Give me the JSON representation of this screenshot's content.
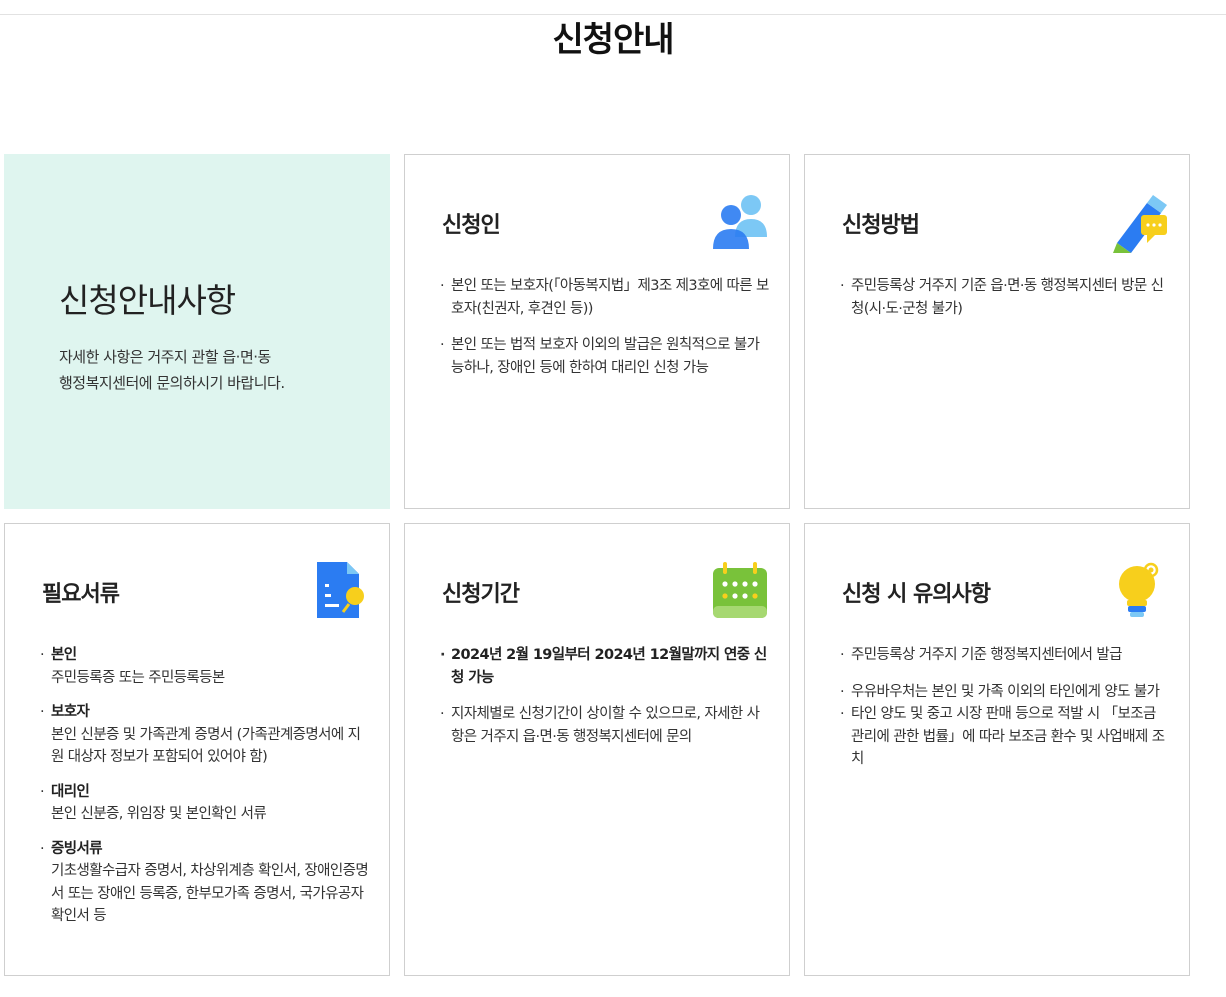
{
  "page": {
    "title": "신청안내"
  },
  "intro": {
    "title": "신청안내사항",
    "desc_line1": "자세한 사항은 거주지 관할 읍·면·동",
    "desc_line2": "행정복지센터에 문의하시기 바랍니다."
  },
  "applicant": {
    "title": "신청인",
    "icon": "people-icon",
    "items": [
      "본인 또는 보호자(「아동복지법」제3조 제3호에 따른 보호자(친권자, 후견인 등))",
      "본인 또는 법적 보호자 이외의 발급은 원칙적으로 불가능하나, 장애인 등에 한하여 대리인 신청 가능"
    ]
  },
  "method": {
    "title": "신청방법",
    "icon": "pen-chat-icon",
    "items": [
      "주민등록상 거주지 기준 읍·면·동 행정복지센터 방문 신청(시·도·군청 불가)"
    ]
  },
  "documents": {
    "title": "필요서류",
    "icon": "document-search-icon",
    "items": [
      {
        "head": "본인",
        "body": "주민등록증 또는 주민등록등본"
      },
      {
        "head": "보호자",
        "body": "본인 신분증 및 가족관계 증명서 (가족관계증명서에 지원 대상자 정보가 포함되어 있어야 함)"
      },
      {
        "head": "대리인",
        "body": "본인 신분증, 위임장 및 본인확인 서류"
      },
      {
        "head": "증빙서류",
        "body": "기초생활수급자 증명서, 차상위계층 확인서, 장애인증명서 또는 장애인 등록증, 한부모가족 증명서, 국가유공자 확인서 등"
      }
    ]
  },
  "period": {
    "title": "신청기간",
    "icon": "calendar-icon",
    "items": [
      "2024년 2월 19일부터 2024년 12월말까지 연중 신청 가능",
      "지자체별로 신청기간이 상이할 수 있으므로, 자세한 사항은 거주지 읍·면·동 행정복지센터에 문의"
    ]
  },
  "notice": {
    "title": "신청 시 유의사항",
    "icon": "lightbulb-icon",
    "items": [
      "주민등록상 거주지 기준 행정복지센터에서 발급",
      "우유바우처는 본인 및 가족 이외의 타인에게 양도 불가",
      "타인 양도 및 중고 시장 판매 등으로 적발 시 「보조금 관리에 관한 법률」에 따라 보조금 환수 및 사업배제 조치"
    ]
  },
  "colors": {
    "intro_bg": "#dff5ef",
    "icon_blue": "#2b7cf2",
    "icon_light_blue": "#7cc8f5",
    "icon_green": "#79c23a",
    "icon_yellow": "#f7cf1c"
  }
}
